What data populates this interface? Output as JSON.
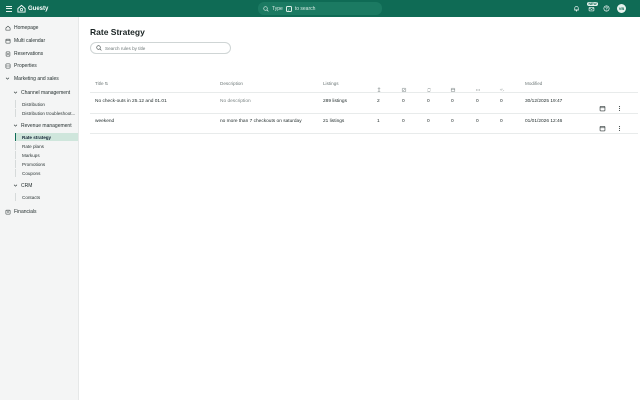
{
  "topbar": {
    "brand": "Guesty",
    "search_prefix": "Type",
    "search_key": "/",
    "search_suffix": "to search",
    "new_badge": "NEW",
    "avatar_initials": "VB",
    "bg_color": "#0f6b55"
  },
  "sidebar": {
    "items": [
      {
        "label": "Homepage",
        "icon": "home-icon"
      },
      {
        "label": "Multi calendar",
        "icon": "calendar-icon"
      },
      {
        "label": "Reservations",
        "icon": "reservations-icon"
      },
      {
        "label": "Properties",
        "icon": "properties-icon"
      },
      {
        "label": "Marketing and sales",
        "icon": "chevron-down-icon"
      },
      {
        "label": "Financials",
        "icon": "financials-icon"
      }
    ],
    "groups": {
      "channel": {
        "label": "Channel management",
        "items": [
          "Distribution",
          "Distribution troubleshoot..."
        ]
      },
      "revenue": {
        "label": "Revenue management",
        "items": [
          "Rate strategy",
          "Rate plans",
          "Markups",
          "Promotions",
          "Coupons"
        ]
      },
      "crm": {
        "label": "CRM",
        "items": [
          "Contacts"
        ]
      }
    },
    "active_item": "Rate strategy"
  },
  "main": {
    "title": "Rate Strategy",
    "search_placeholder": "Search rules by title",
    "columns": {
      "title": "Title",
      "description": "Description",
      "listings": "Listings",
      "modified": "Modified"
    },
    "rows": [
      {
        "title": "No check-outs in 25.12 and 01.01",
        "description": "No description",
        "listings": "289 listings",
        "c1": "2",
        "c2": "0",
        "c3": "0",
        "c4": "0",
        "c5": "0",
        "c6": "0",
        "modified": "30/12/2025 19:47"
      },
      {
        "title": "weekend",
        "description": "no more than 7 checkouts on saturday",
        "listings": "21 listings",
        "c1": "1",
        "c2": "0",
        "c3": "0",
        "c4": "0",
        "c5": "0",
        "c6": "0",
        "modified": "01/01/2026 12:46"
      }
    ]
  }
}
